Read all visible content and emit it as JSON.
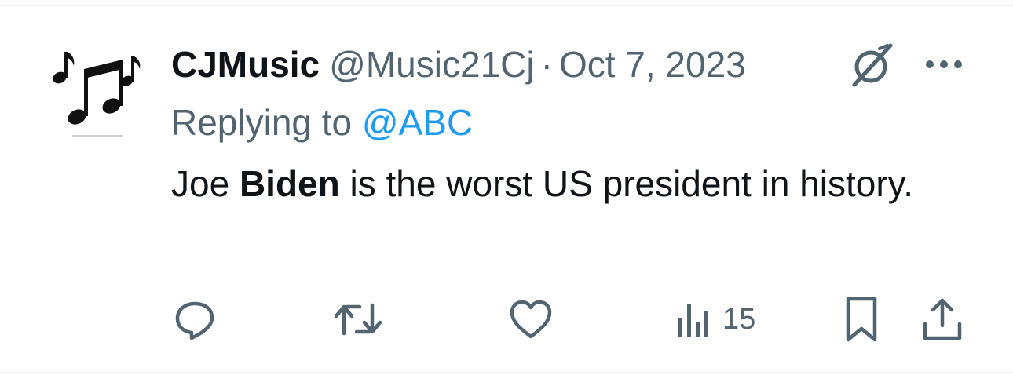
{
  "tweet": {
    "display_name": "CJMusic",
    "handle": "@Music21Cj",
    "separator": "·",
    "date": "Oct 7, 2023",
    "reply_prefix": "Replying to ",
    "reply_mention": "@ABC",
    "text_before": "Joe ",
    "text_bold": "Biden",
    "text_after": " is the worst US president in history."
  },
  "icons": {
    "avatar": "music-notes-avatar",
    "grok": "grok-slash-icon",
    "more": "more-dots-icon",
    "reply": "reply-icon",
    "retweet": "retweet-icon",
    "like": "heart-icon",
    "views": "views-bar-chart-icon",
    "bookmark": "bookmark-icon",
    "share": "share-icon"
  },
  "actions": {
    "views_count": "15"
  },
  "colors": {
    "text_primary": "#0f1419",
    "text_secondary": "#536471",
    "link": "#1d9bf0",
    "divider": "#eff3f4"
  }
}
